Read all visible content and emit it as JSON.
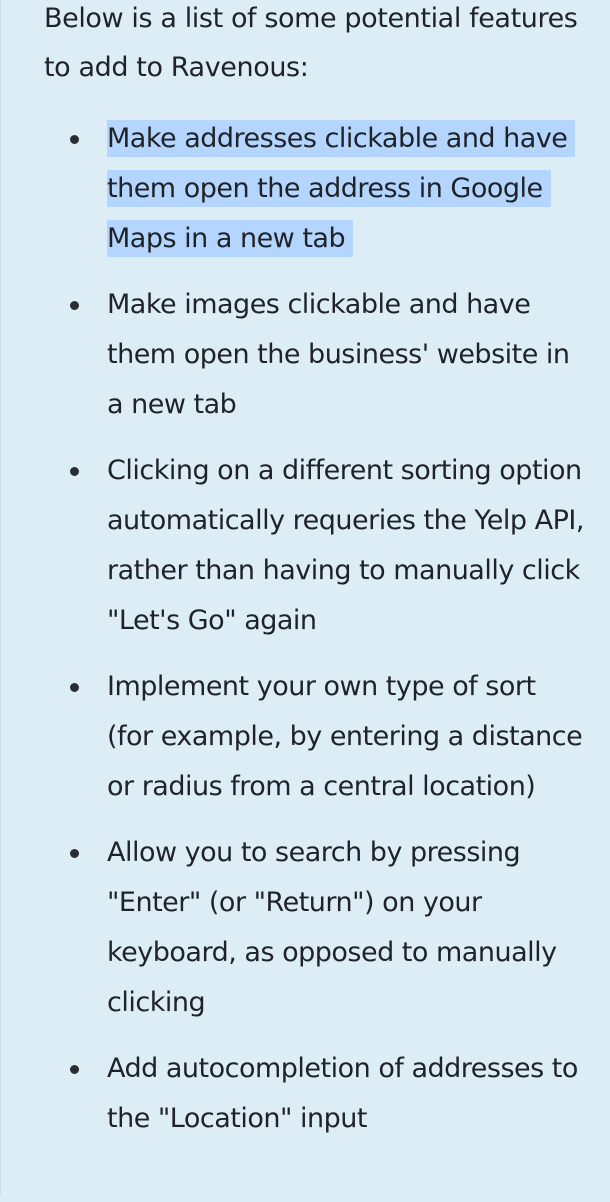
{
  "intro": "Below is a list of some potential features to add to Ravenous:",
  "features": [
    "Make addresses clickable and have them open the address in Google Maps in a new tab",
    "Make images clickable and have them open the business' website in a new tab",
    "Clicking on a different sorting option automatically requeries the Yelp API, rather than having to manually click \"Let's Go\" again",
    "Implement your own type of sort (for example, by entering a distance or radius from a central location)",
    "Allow you to search by pressing \"Enter\" (or \"Return\") on your keyboard, as opposed to manually clicking",
    "Add autocompletion of addresses to the \"Location\" input"
  ]
}
